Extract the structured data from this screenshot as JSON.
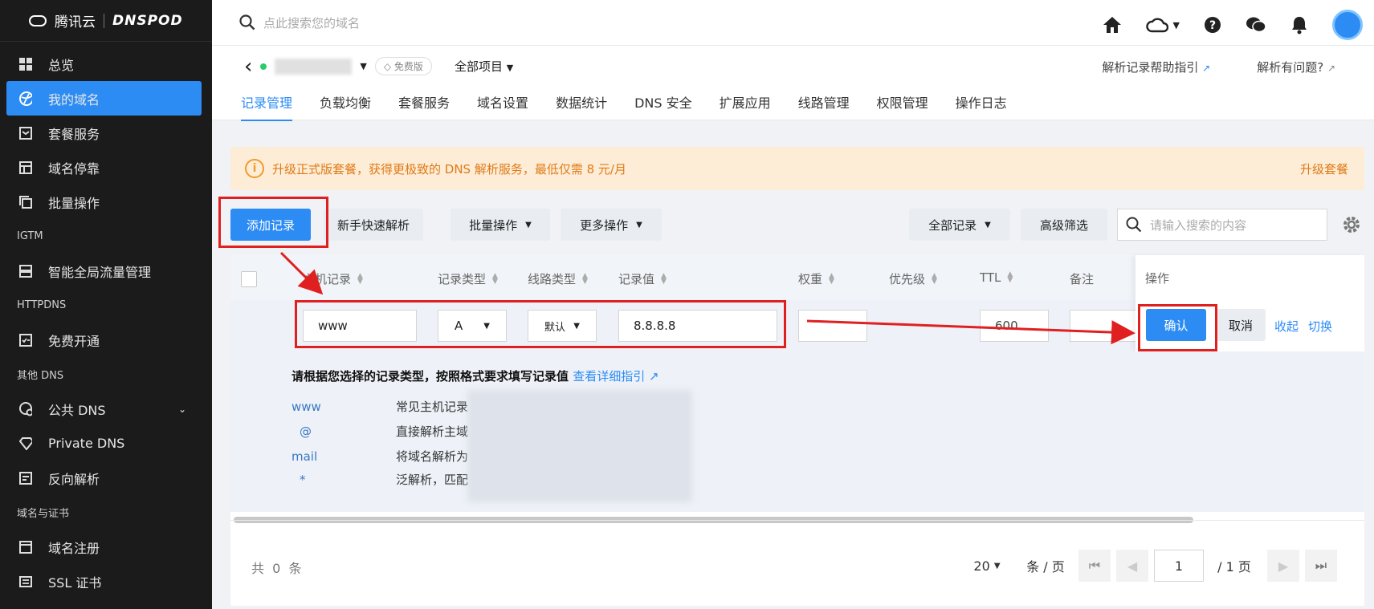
{
  "sidebar": {
    "brand": "腾讯云",
    "product": "DNSPOD",
    "items": [
      {
        "label": "总览",
        "icon": "grid-icon",
        "type": "item"
      },
      {
        "label": "我的域名",
        "icon": "globe-icon",
        "type": "item",
        "active": true
      },
      {
        "label": "套餐服务",
        "icon": "package-icon",
        "type": "item"
      },
      {
        "label": "域名停靠",
        "icon": "layout-icon",
        "type": "item"
      },
      {
        "label": "批量操作",
        "icon": "copy-icon",
        "type": "item"
      },
      {
        "label": "IGTM",
        "type": "group"
      },
      {
        "label": "智能全局流量管理",
        "icon": "server-icon",
        "type": "item"
      },
      {
        "label": "HTTPDNS",
        "type": "group"
      },
      {
        "label": "免费开通",
        "icon": "checklist-icon",
        "type": "item"
      },
      {
        "label": "其他 DNS",
        "type": "group"
      },
      {
        "label": "公共 DNS",
        "icon": "globe-gear-icon",
        "type": "item",
        "caret": true
      },
      {
        "label": "Private DNS",
        "icon": "diamond-icon",
        "type": "item"
      },
      {
        "label": "反向解析",
        "icon": "reverse-icon",
        "type": "item"
      },
      {
        "label": "域名与证书",
        "type": "group"
      },
      {
        "label": "域名注册",
        "icon": "window-icon",
        "type": "item"
      },
      {
        "label": "SSL 证书",
        "icon": "certificate-icon",
        "type": "item"
      }
    ]
  },
  "topbar": {
    "search_placeholder": "点此搜索您的域名"
  },
  "subhead": {
    "free_badge": "免费版",
    "project": "全部项目",
    "help_link": "解析记录帮助指引",
    "question_link": "解析有问题?",
    "tabs": [
      "记录管理",
      "负载均衡",
      "套餐服务",
      "域名设置",
      "数据统计",
      "DNS 安全",
      "扩展应用",
      "线路管理",
      "权限管理",
      "操作日志"
    ]
  },
  "notice": {
    "text": "升级正式版套餐，获得更极致的 DNS 解析服务，最低仅需 8 元/月",
    "action": "升级套餐"
  },
  "toolbar": {
    "add_record": "添加记录",
    "quick_resolve": "新手快速解析",
    "batch": "批量操作",
    "more": "更多操作",
    "all_records": "全部记录",
    "advanced_filter": "高级筛选",
    "search_placeholder": "请输入搜索的内容"
  },
  "table": {
    "headers": {
      "host": "主机记录",
      "type": "记录类型",
      "line": "线路类型",
      "value": "记录值",
      "weight": "权重",
      "priority": "优先级",
      "ttl": "TTL",
      "remark": "备注",
      "action": "操作"
    },
    "edit": {
      "host": "www",
      "type": "A",
      "line": "默认",
      "value": "8.8.8.8",
      "ttl": "600",
      "confirm": "确认",
      "cancel": "取消",
      "collapse": "收起",
      "switch": "切换"
    }
  },
  "guide": {
    "title": "请根据您选择的记录类型，按照格式要求填写记录值",
    "link": "查看详细指引",
    "rows": [
      {
        "key": "www",
        "desc": "常见主机记录"
      },
      {
        "key": "@",
        "desc": "直接解析主域"
      },
      {
        "key": "mail",
        "desc": "将域名解析为"
      },
      {
        "key": "*",
        "desc": "泛解析，匹配"
      }
    ]
  },
  "footer": {
    "total": "共  0  条",
    "page_size": "20",
    "per_page": "条 / 页",
    "current_page": "1",
    "total_pages": "/ 1 页"
  },
  "colors": {
    "primary": "#2c8cf4",
    "sidebar_bg": "#1b1b1b",
    "notice_bg": "#fdedd7",
    "notice_text": "#e07a17",
    "annotation": "#e02020"
  }
}
